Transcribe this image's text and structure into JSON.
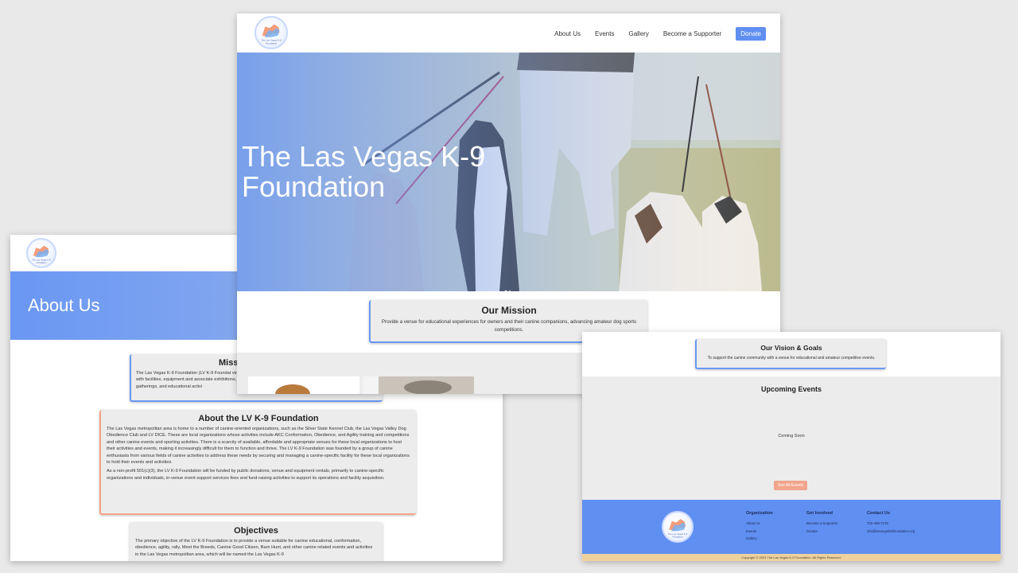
{
  "about_page": {
    "title": "About Us",
    "mission": {
      "heading": "Miss",
      "text": "The Las Vegas K-9 Foundation (LV K-9 Foundat venue with facilities, equipment and associate exhibitions, gatherings, and educational activi"
    },
    "lvk9": {
      "heading": "About the LV K-9 Foundation",
      "p1": "The Las Vegas metropolitan area is home to a number of canine-oriented organizations, such as the Silver State Kennel Club, the Las Vegas Valley Dog Obedience Club and LV DICE. These are local organizations whose activities include AKC Conformation, Obedience, and Agility training and competitions and other canine events and sporting activities. There is a scarcity of available, affordable and appropriate venues for these local organizations to host their activities and events, making it increasingly difficult for them to function and thrive. The LV K-9 Foundation was founded by a group of canine enthusiasts from various fields of canine activities to address these needs by securing and managing a canine-specific facility for these local organizations to hold their events and activities.",
      "p2": "As a non-profit 501(c)(3), the LV K-9 Foundation will be funded by public donations, venue and equipment rentals, primarily to canine-specific organizations and individuals, in-venue event support services fees and fund-raising activities to support its operations and facility acquisition."
    },
    "objectives": {
      "heading": "Objectives",
      "text": "The primary objective of the LV K-9 Foundation is to provide a venue suitable for canine educational, conformation, obedience, agility, rally, Meet the Breeds, Canine Good Citizen, Barn Hunt, and other canine related events and activities in the Las Vegas metropolitan area, which will be named the Las Vegas K-9"
    }
  },
  "home_page": {
    "nav": [
      "About Us",
      "Events",
      "Gallery",
      "Become a Supporter"
    ],
    "donate": "Donate",
    "hero_title": "The Las Vegas K-9 Foundation",
    "mission_heading": "Our Mission",
    "mission_text": "Provide a venue for educational experiences for owners and their canine companions, advancing amateur dog sports competitions."
  },
  "events_page": {
    "vision_heading": "Our Vision & Goals",
    "vision_text": "To support the canine community with a venue for educational and amateur competitive events.",
    "upcoming_heading": "Upcoming Events",
    "coming_soon": "Coming Soon",
    "see_all": "See All Events",
    "footer": {
      "organization": {
        "heading": "Organization",
        "links": [
          "About Us",
          "Events",
          "Gallery"
        ]
      },
      "get_involved": {
        "heading": "Get Involved",
        "links": [
          "Become a Supporter",
          "Donate"
        ]
      },
      "contact": {
        "heading": "Contact Us",
        "lines": [
          "702-468-7178",
          "info@lasvegask9foundation.org"
        ]
      }
    },
    "copyright": "Copyright © 2023 The Las Vegas K-9 Foundation. All Rights Reserved."
  },
  "logo_text": "The Las Vegas K-9 Foundation",
  "colors": {
    "brand_blue": "#5f8ff1",
    "accent_peach": "#f2a58c",
    "card_gray": "#ececec",
    "copyright_band": "#efd19b"
  }
}
